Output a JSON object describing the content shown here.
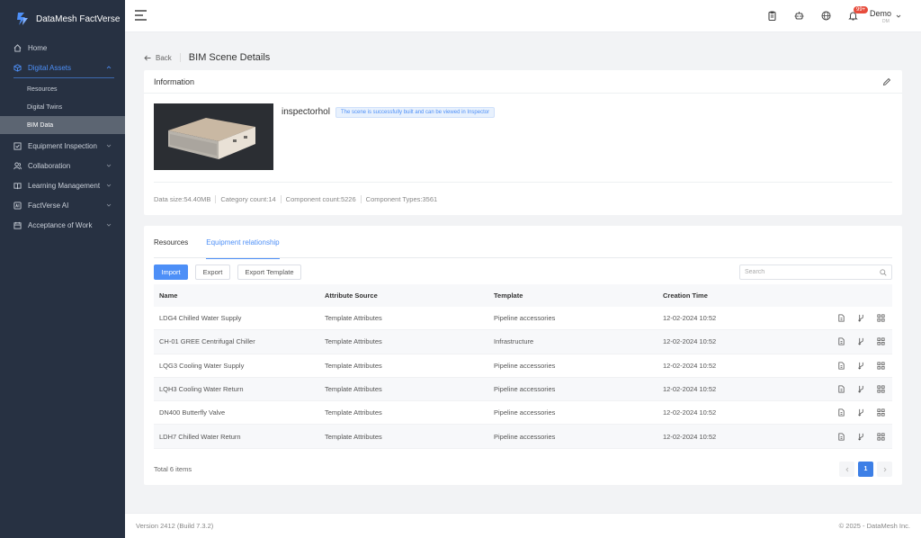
{
  "app": {
    "title": "DataMesh FactVerse"
  },
  "sidebar": {
    "items": [
      {
        "label": "Home",
        "icon": "home-icon"
      },
      {
        "label": "Digital Assets",
        "icon": "cube-icon"
      },
      {
        "label": "Equipment Inspection",
        "icon": "checklist-icon"
      },
      {
        "label": "Collaboration",
        "icon": "users-icon"
      },
      {
        "label": "Learning Management",
        "icon": "book-icon"
      },
      {
        "label": "FactVerse AI",
        "icon": "ai-icon"
      },
      {
        "label": "Acceptance of Work",
        "icon": "calendar-icon"
      }
    ],
    "subitems": [
      {
        "label": "Resources"
      },
      {
        "label": "Digital Twins"
      },
      {
        "label": "BIM Data"
      }
    ]
  },
  "header": {
    "notification_badge": "99+",
    "user_name": "Demo",
    "user_sub": "DM"
  },
  "page": {
    "back_label": "Back",
    "title": "BIM Scene Details"
  },
  "info": {
    "heading": "Information",
    "scene_name": "inspectorhol",
    "status_tag": "The scene is successfully built and can be viewed in Inspector",
    "stats": {
      "data_size": "Data size:54.40MB",
      "category_count": "Category count:14",
      "component_count": "Component count:5226",
      "component_types": "Component Types:3561"
    }
  },
  "tabs": [
    {
      "label": "Resources"
    },
    {
      "label": "Equipment relationship"
    }
  ],
  "toolbar": {
    "import_label": "Import",
    "export_label": "Export",
    "export_template_label": "Export Template",
    "search_placeholder": "Search"
  },
  "table": {
    "columns": [
      "Name",
      "Attribute Source",
      "Template",
      "Creation Time"
    ],
    "rows": [
      {
        "name": "LDG4 Chilled Water Supply",
        "source": "Template Attributes",
        "template": "Pipeline accessories",
        "time": "12-02-2024 10:52"
      },
      {
        "name": "CH-01 GREE Centrifugal Chiller",
        "source": "Template Attributes",
        "template": "Infrastructure",
        "time": "12-02-2024 10:52"
      },
      {
        "name": "LQG3 Cooling Water Supply",
        "source": "Template Attributes",
        "template": "Pipeline accessories",
        "time": "12-02-2024 10:52"
      },
      {
        "name": "LQH3 Cooling Water Return",
        "source": "Template Attributes",
        "template": "Pipeline accessories",
        "time": "12-02-2024 10:52"
      },
      {
        "name": "DN400 Butterfly Valve",
        "source": "Template Attributes",
        "template": "Pipeline accessories",
        "time": "12-02-2024 10:52"
      },
      {
        "name": "LDH7 Chilled Water Return",
        "source": "Template Attributes",
        "template": "Pipeline accessories",
        "time": "12-02-2024 10:52"
      }
    ],
    "total_label": "Total 6 items",
    "current_page": "1"
  },
  "footer": {
    "version": "Version 2412 (Build 7.3.2)",
    "copyright": "© 2025 - DataMesh Inc."
  },
  "colors": {
    "sidebar_bg": "#273142",
    "accent": "#4d8ff7",
    "badge": "#e74c3c"
  }
}
